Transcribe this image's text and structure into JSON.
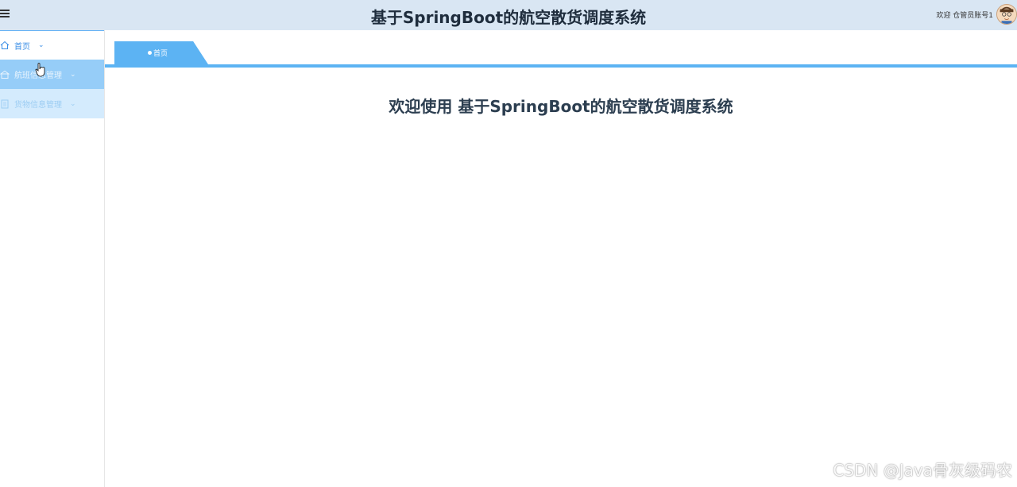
{
  "header": {
    "title": "基于SpringBoot的航空散货调度系统",
    "menu_toggle_icon": "hamburger-icon",
    "welcome_text": "欢迎 仓管员账号1",
    "avatar_icon": "user-avatar-icon",
    "background": "#d9e6f3"
  },
  "sidebar": {
    "items": [
      {
        "label": "首页",
        "icon": "home-icon",
        "chevron": "chevron-down-icon"
      },
      {
        "label": "航班信息管理",
        "icon": "building-icon",
        "chevron": "chevron-down-icon"
      },
      {
        "label": "货物信息管理",
        "icon": "document-icon",
        "chevron": "chevron-down-icon"
      }
    ],
    "accent": "#5cb3f3"
  },
  "tabs": [
    {
      "label": "首页",
      "active": true
    }
  ],
  "main": {
    "welcome_heading": "欢迎使用 基于SpringBoot的航空散货调度系统"
  },
  "watermark": "CSDN @Java骨灰级码农"
}
